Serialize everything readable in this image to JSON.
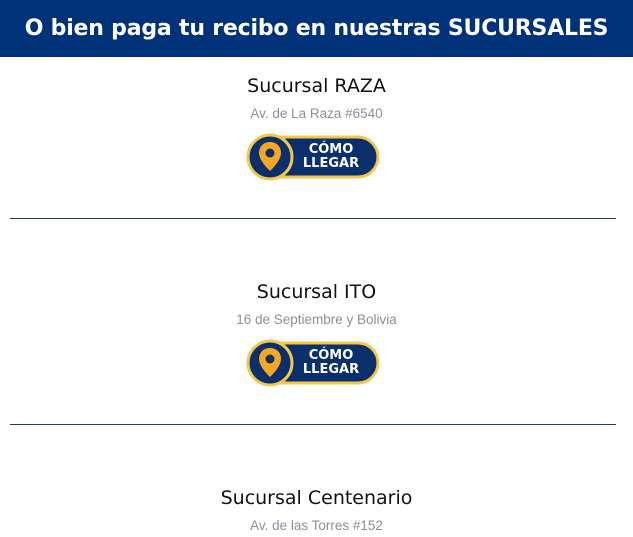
{
  "header": {
    "title": "O bien paga tu recibo en nuestras SUCURSALES"
  },
  "branches": [
    {
      "name": "Sucursal RAZA",
      "address": "Av. de La Raza #6540",
      "button_line1": "CÓMO",
      "button_line2": "LLEGAR"
    },
    {
      "name": "Sucursal ITO",
      "address": "16 de Septiembre y Bolivia",
      "button_line1": "CÓMO",
      "button_line2": "LLEGAR"
    },
    {
      "name": "Sucursal Centenario",
      "address": "Av. de las Torres #152"
    }
  ],
  "colors": {
    "header_bg": "#00327a",
    "button_bg": "#0a2f6b",
    "button_border": "#f2c94c",
    "pin": "#f5a623"
  }
}
